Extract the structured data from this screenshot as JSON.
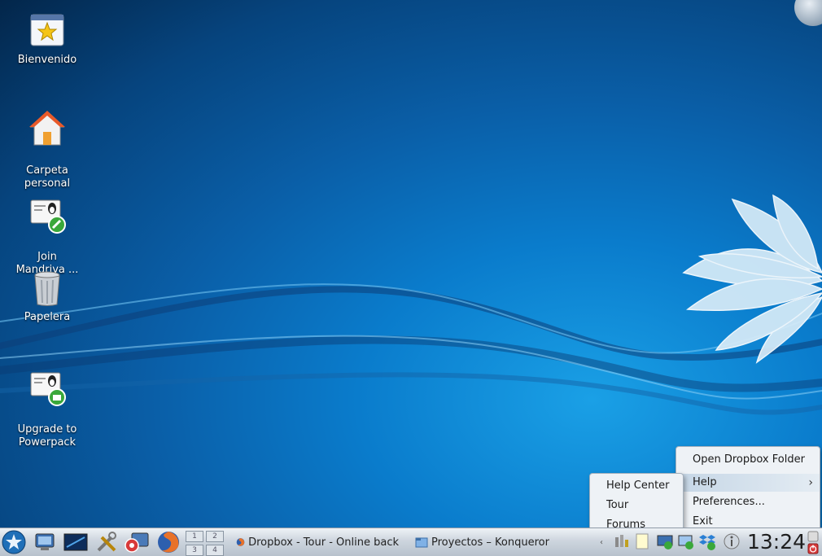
{
  "desktop": {
    "icons": [
      {
        "label": "Bienvenido"
      },
      {
        "label": "Carpeta\npersonal"
      },
      {
        "label": "Join\nMandriva ..."
      },
      {
        "label": "Papelera"
      },
      {
        "label": "Upgrade to\nPowerpack"
      }
    ]
  },
  "taskbar": {
    "pager": [
      "1",
      "2",
      "3",
      "4"
    ],
    "tasks": [
      {
        "label": "Dropbox - Tour - Online back"
      },
      {
        "label": "Proyectos – Konqueror"
      }
    ],
    "clock": "13:24"
  },
  "dropbox_menu": {
    "items": [
      {
        "label": "Open Dropbox Folder"
      },
      {
        "label": "Help"
      },
      {
        "label": "Preferences..."
      },
      {
        "label": "Exit"
      }
    ]
  },
  "help_submenu": {
    "items": [
      {
        "label": "Help Center"
      },
      {
        "label": "Tour"
      },
      {
        "label": "Forums"
      }
    ]
  },
  "colors": {
    "taskbar": "#cdd5de",
    "menu_bg": "#eef2f6",
    "menu_highlight": "#c5d6e6"
  }
}
